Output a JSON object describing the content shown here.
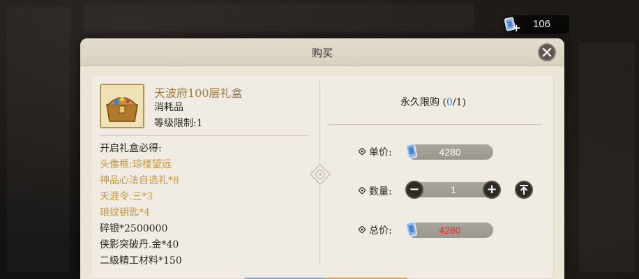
{
  "currency": {
    "icon": "coupon-token-icon",
    "amount": "106"
  },
  "dialog": {
    "title": "购买",
    "close_icon": "close-icon"
  },
  "item": {
    "name": "天波府100层礼盒",
    "type": "消耗品",
    "level_req": "等级限制:1",
    "icon": "gift-chest-icon"
  },
  "rewards": {
    "heading": "开启礼盒必得:",
    "items": [
      {
        "text": "头像框:琼楼望远",
        "style": "gold"
      },
      {
        "text": "神品心法自选礼*8",
        "style": "gold"
      },
      {
        "text": "天涯令.三*3",
        "style": "gold"
      },
      {
        "text": "琅纹钥匙*4",
        "style": "gold"
      },
      {
        "text": "碎银*2500000",
        "style": "dark"
      },
      {
        "text": "侠影突破丹.金*40",
        "style": "dark"
      },
      {
        "text": "二级精工材料*150",
        "style": "dark"
      }
    ]
  },
  "purchase": {
    "limit_label": "永久限购 (",
    "limit_current": "0",
    "limit_rest": "/1)",
    "unit_price_label": "单价:",
    "unit_price": "4280",
    "quantity_label": "数量:",
    "quantity": "1",
    "total_label": "总价:",
    "total_price": "4280",
    "minus_label": "−",
    "plus_label": "+"
  },
  "colors": {
    "accent_gold": "#c4973a",
    "limit_blue": "#2f7ad6",
    "total_red": "#d4322c",
    "dialog_bg": "#ece6d9"
  }
}
